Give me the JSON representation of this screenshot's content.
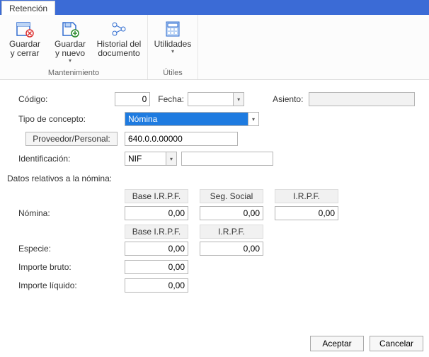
{
  "window": {
    "tab": "Retención"
  },
  "ribbon": {
    "save_close": "Guardar\ny cerrar",
    "save_new": "Guardar\ny nuevo",
    "history": "Historial del\ndocumento",
    "utilities": "Utilidades",
    "group_maint": "Mantenimiento",
    "group_util": "Útiles"
  },
  "form": {
    "codigo_label": "Código:",
    "codigo_value": "0",
    "fecha_label": "Fecha:",
    "fecha_value": "",
    "asiento_label": "Asiento:",
    "asiento_value": "",
    "tipo_label": "Tipo de concepto:",
    "tipo_value": "Nómina",
    "prov_btn": "Proveedor/Personal:",
    "prov_value": "640.0.0.00000",
    "ident_label": "Identificación:",
    "ident_sel": "NIF",
    "ident_value": ""
  },
  "nomina": {
    "section": "Datos relativos a la nómina:",
    "h_base": "Base I.R.P.F.",
    "h_ss": "Seg. Social",
    "h_irpf": "I.R.P.F.",
    "row_nomina": "Nómina:",
    "row_especie": "Especie:",
    "row_bruto": "Importe bruto:",
    "row_liquido": "Importe líquido:",
    "zero": "0,00"
  },
  "footer": {
    "ok": "Aceptar",
    "cancel": "Cancelar"
  }
}
